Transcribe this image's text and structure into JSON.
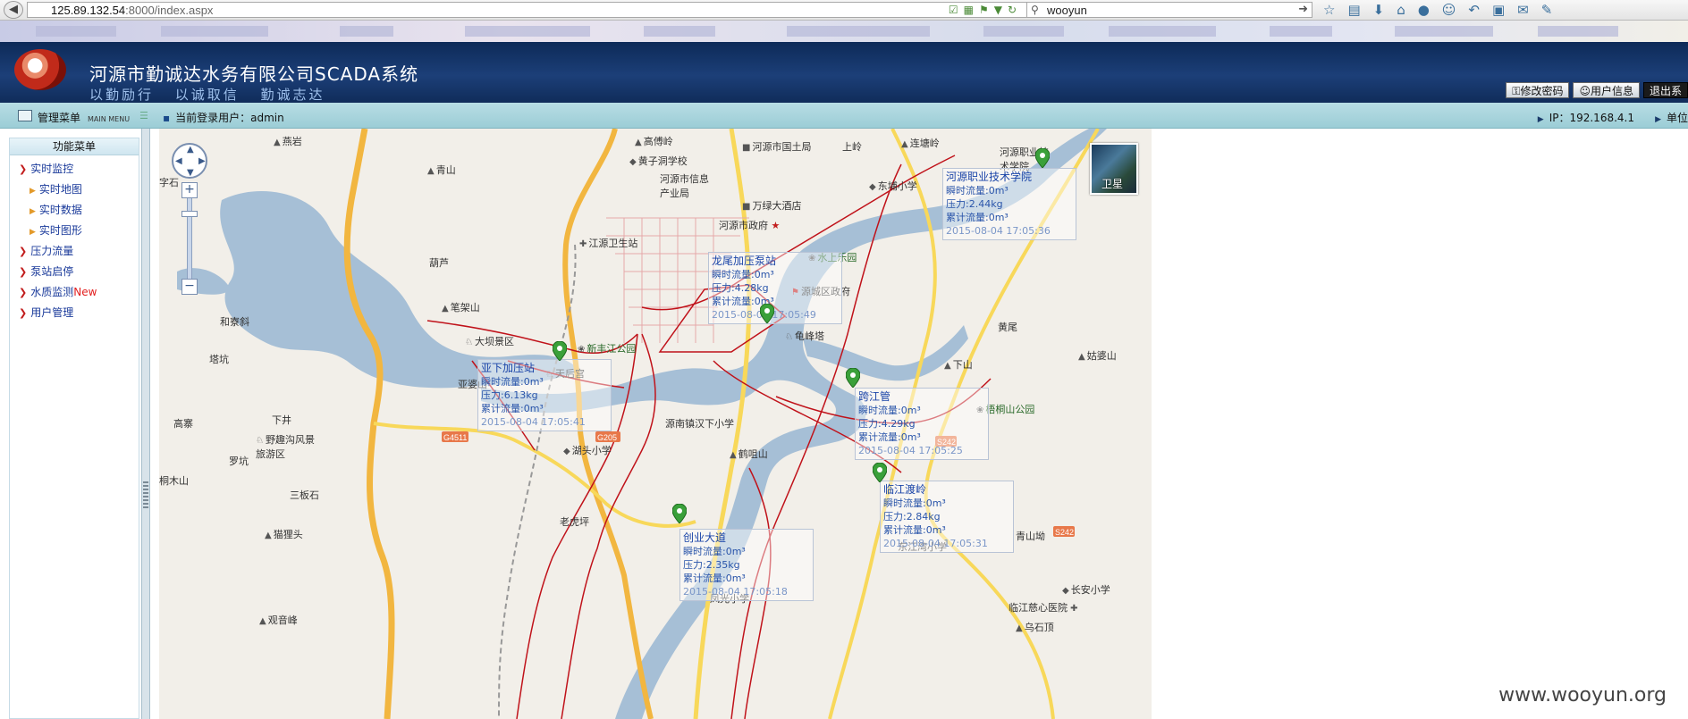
{
  "browser": {
    "url_host": "125.89.132.54",
    "url_rest": ":8000/index.aspx",
    "search_value": "wooyun"
  },
  "header": {
    "title": "河源市勤诚达水务有限公司SCADA系统",
    "slogan": "以勤励行  以诚取信  勤诚志达",
    "buttons": {
      "change_password": "修改密码",
      "user_info": "用户信息",
      "logout": "退出系"
    }
  },
  "subbar": {
    "menu_title": "管理菜单",
    "menu_title_en": "MAIN MENU",
    "login_label": "当前登录用户：admin",
    "ip": "IP：192.168.4.1",
    "unit": "单位"
  },
  "sidebar": {
    "heading": "功能菜单",
    "items": [
      {
        "label": "实时监控",
        "level": "top"
      },
      {
        "label": "实时地图",
        "level": "sub"
      },
      {
        "label": "实时数据",
        "level": "sub"
      },
      {
        "label": "实时图形",
        "level": "sub"
      },
      {
        "label": "压力流量",
        "level": "top"
      },
      {
        "label": "泵站启停",
        "level": "top"
      },
      {
        "label": "水质监测",
        "level": "top",
        "badge": "New"
      },
      {
        "label": "用户管理",
        "level": "top"
      }
    ]
  },
  "map": {
    "satellite_label": "卫星",
    "zoom_in": "+",
    "zoom_out": "−",
    "stations": [
      {
        "name": "河源职业技术学院",
        "flow": "瞬时流量:0m³",
        "pressure": "压力:2.44kg",
        "total": "累计流量:0m³",
        "time": "2015-08-04 17:05:36"
      },
      {
        "name": "龙尾加压泵站",
        "flow": "瞬时流量:0m³",
        "pressure": "压力:4.28kg",
        "total": "累计流量:0m³",
        "time": "2015-08-04 17:05:49"
      },
      {
        "name": "亚下加压站",
        "flow": "瞬时流量:0m³",
        "pressure": "压力:6.13kg",
        "total": "累计流量:0m³",
        "time": "2015-08-04 17:05:41"
      },
      {
        "name": "跨江管",
        "flow": "瞬时流量:0m³",
        "pressure": "压力:4.29kg",
        "total": "累计流量:0m³",
        "time": "2015-08-04 17:05:25"
      },
      {
        "name": "临江渡岭",
        "flow": "瞬时流量:0m³",
        "pressure": "压力:2.84kg",
        "total": "累计流量:0m³",
        "time": "2015-08-04 17:05:31"
      },
      {
        "name": "创业大道",
        "flow": "瞬时流量:0m³",
        "pressure": "压力:2.35kg",
        "total": "累计流量:0m³",
        "time": "2015-08-04 17:05:18"
      }
    ],
    "places": {
      "p1": "燕岩",
      "p2": "青山",
      "p3": "高傅岭",
      "p4": "河源市国土局",
      "p5": "上岭",
      "p6": "连塘岭",
      "p7": "黄子洞学校",
      "p8": "河源市信息产业局",
      "p9": "万绿大酒店",
      "p10": "河源市政府",
      "p11": "东埔小学",
      "p12": "江源卫生站",
      "p13": "葫芦",
      "p14": "水上乐园",
      "p15": "源城区政府",
      "p16": "笔架山",
      "p17": "和寮斜",
      "p18": "大坝景区",
      "p19": "新丰江公园",
      "p20": "龟峰塔",
      "p21": "黄尾",
      "p22": "下山",
      "p23": "姑婆山",
      "p24": "塔坑",
      "p25": "天后宫",
      "p26": "亚婆山",
      "p27": "梧桐山公园",
      "p28": "下井",
      "p29": "高寨",
      "p30": "野趣沟风景旅游区",
      "p31": "湖头小学",
      "p32": "源南镇汉下小学",
      "p33": "鹤咀山",
      "p34": "罗坑",
      "p35": "桐木山",
      "p36": "三板石",
      "p37": "猫狸头",
      "p38": "老虎坪",
      "p39": "青山坳",
      "p40": "长安小学",
      "p41": "临江慈心医院",
      "p42": "观音峰",
      "p43": "乌石顶",
      "p44": "凤光小学",
      "p45": "河源职业技术学院",
      "p46": "字石",
      "p47": "东江湾小学"
    },
    "road_badges": {
      "g1": "G4511",
      "g2": "G205",
      "g3": "S242",
      "g4": "S242"
    }
  },
  "watermark": "www.wooyun.org"
}
